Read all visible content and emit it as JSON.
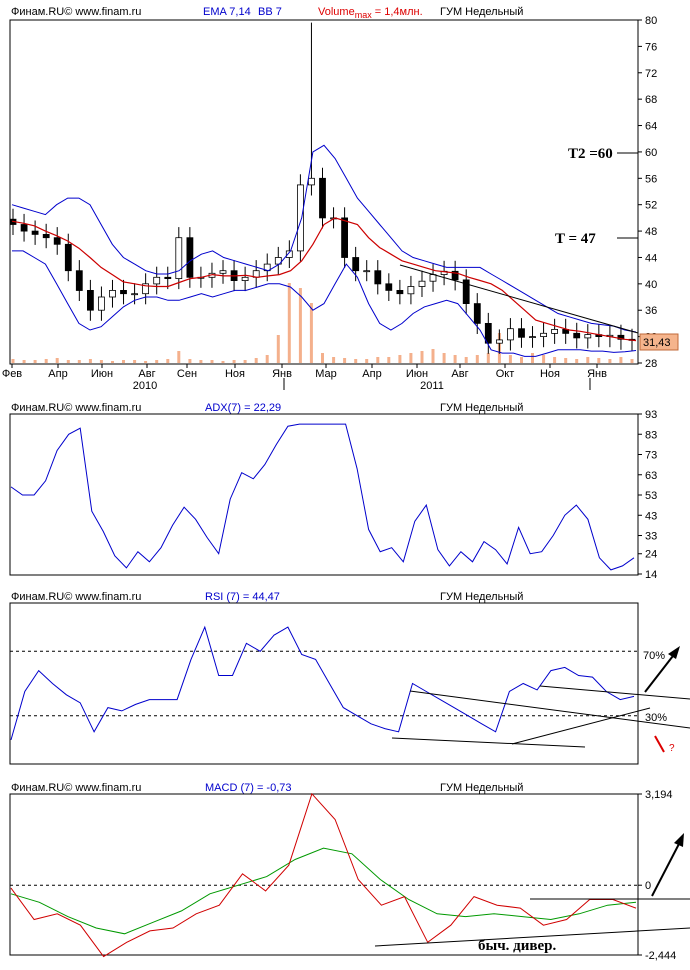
{
  "source_label": "Финам.RU© www.finam.ru",
  "instrument": "ГУМ Недельный",
  "panels": {
    "price": {
      "indicators": [
        "EMA 7,14",
        "BB 7"
      ],
      "volume_prefix": "Volume",
      "volume_sub": "max",
      "volume_value": " = 1,4млн.",
      "last_price": "31,43",
      "annotations": [
        "T2 =60",
        "T = 47"
      ]
    },
    "adx": {
      "label": "ADX(7) = 22,29"
    },
    "rsi": {
      "label": "RSI (7) = 44,47",
      "level_high": "70%",
      "level_low": "30%",
      "question": "?"
    },
    "macd": {
      "label": "MACD (7) = -0,73",
      "divergence_note": "быч. дивер."
    }
  },
  "colors": {
    "price_up": "#ffffff",
    "price_down": "#000000",
    "ema": "#cc0000",
    "bb": "#0000cc",
    "volume": "#f4b08c",
    "adx": "#0000cc",
    "rsi": "#0000cc",
    "macd": "#d00000",
    "macd_signal": "#009900",
    "last_price_bg": "#f5b48c",
    "header_blue": "#0000cc",
    "header_red": "#dd0000"
  },
  "chart_data": [
    {
      "type": "line",
      "subtype": "candlestick",
      "yaxis_side": "right",
      "ylim": [
        28,
        80
      ],
      "yticks": [
        28,
        32,
        36,
        40,
        44,
        48,
        52,
        56,
        60,
        64,
        68,
        72,
        76,
        80
      ],
      "xtick_labels": [
        "Фев",
        "Апр",
        "Июн",
        "Авг",
        "Сен",
        "Ноя",
        "Янв",
        "Мар",
        "Апр",
        "Июн",
        "Авг",
        "Окт",
        "Ноя",
        "Янв"
      ],
      "year_labels": [
        "2010",
        "2011"
      ],
      "series": [
        {
          "name": "EMA 7,14",
          "values": [
            49.5,
            49.2,
            48.8,
            48.0,
            47.3,
            46.5,
            45.4,
            44.0,
            42.5,
            41.4,
            40.3,
            40.0,
            39.7,
            39.6,
            39.6,
            40.2,
            40.8,
            41.0,
            41.4,
            41.2,
            41.2,
            41.3,
            41.0,
            41.2,
            41.4,
            42.0,
            43.5,
            46.0,
            49.0,
            50.0,
            49.5,
            49.0,
            47.0,
            45.5,
            44.5,
            43.5,
            43.0,
            42.5,
            42.0,
            41.8,
            41.6,
            41.0,
            40.5,
            40.0,
            39.0,
            37.5,
            36.0,
            34.5,
            34.0,
            33.5,
            33.0,
            32.8,
            32.5,
            32.2,
            31.9,
            31.6,
            31.4
          ]
        },
        {
          "name": "BB 7 upper",
          "values": [
            52,
            51.5,
            51,
            50.5,
            52,
            53,
            53,
            52,
            49,
            46,
            44,
            43,
            42,
            41.5,
            41.5,
            42,
            43.5,
            44.5,
            45,
            44,
            43.5,
            43,
            42.5,
            42,
            43,
            45,
            50,
            60,
            61,
            59,
            56,
            53,
            51,
            49,
            47,
            45,
            44,
            43.5,
            43,
            42.5,
            42.5,
            42.5,
            42.5,
            41.5,
            40.5,
            39.5,
            38.5,
            37.5,
            36.5,
            35.5,
            35,
            34.5,
            34,
            33.8,
            33.6,
            33,
            32.7
          ]
        },
        {
          "name": "BB 7 lower",
          "values": [
            45,
            45,
            44,
            43,
            40,
            37,
            34,
            33,
            33.5,
            35,
            36.5,
            37.5,
            38,
            38,
            37.5,
            37.5,
            38,
            38.5,
            38,
            38.5,
            39,
            39,
            39.5,
            40,
            40,
            39.5,
            38,
            36,
            37,
            40,
            43,
            41,
            37,
            34,
            33,
            34,
            35.5,
            36.5,
            37,
            37.5,
            37,
            35,
            33,
            30,
            29.5,
            29.5,
            29,
            29,
            29.5,
            30,
            30,
            30,
            29.8,
            29.8,
            29.6,
            29.7,
            29.9
          ]
        },
        {
          "name": "close",
          "values": [
            49,
            48,
            47.5,
            47,
            46,
            42,
            39,
            36,
            38,
            39,
            38.5,
            38.5,
            40,
            41,
            40.8,
            47,
            41,
            41,
            41.6,
            42,
            40.5,
            41,
            42,
            43,
            44,
            45,
            55,
            56,
            50,
            50,
            44,
            42,
            42,
            40,
            39,
            38.5,
            39.6,
            40.4,
            41.4,
            41.9,
            40.6,
            37,
            34,
            31,
            31.5,
            33.2,
            31.9,
            32,
            32.5,
            33.1,
            32.5,
            31.8,
            32.3,
            32,
            32.2,
            31.6,
            31.43
          ]
        }
      ]
    },
    {
      "type": "line",
      "yaxis_side": "right",
      "ylim": [
        14,
        93
      ],
      "yticks": [
        14,
        24,
        33,
        43,
        53,
        63,
        73,
        83,
        93
      ],
      "series": [
        {
          "name": "ADX(7)",
          "values": [
            57,
            53,
            53,
            60,
            75,
            83,
            86,
            45,
            35,
            23,
            17,
            25,
            20,
            27,
            38,
            47,
            41,
            32,
            24,
            51,
            64,
            61,
            68,
            78,
            87,
            88,
            88,
            88,
            88,
            88,
            66,
            36,
            25,
            27,
            20,
            40,
            48,
            26,
            18,
            25,
            20,
            30,
            26,
            19,
            37,
            24,
            25,
            33,
            43,
            48,
            41,
            22,
            16,
            18,
            22
          ]
        }
      ]
    },
    {
      "type": "line",
      "yaxis_side": "right",
      "ylim": [
        0,
        100
      ],
      "levels": [
        70,
        30
      ],
      "series": [
        {
          "name": "RSI (7)",
          "values": [
            15,
            45,
            58,
            50,
            43,
            38,
            20,
            35,
            33,
            37,
            40,
            40,
            40,
            65,
            85,
            55,
            55,
            75,
            70,
            80,
            85,
            68,
            65,
            50,
            35,
            30,
            25,
            22,
            20,
            50,
            45,
            40,
            35,
            30,
            25,
            20,
            45,
            50,
            46,
            58,
            60,
            55,
            54,
            45,
            40,
            42
          ]
        }
      ]
    },
    {
      "type": "line",
      "yaxis_side": "right",
      "yticks": [
        -2.444,
        0,
        3.194
      ],
      "ytick_labels": [
        "-2,444",
        "0",
        "3,194"
      ],
      "series": [
        {
          "name": "MACD (7)",
          "values": [
            -0.1,
            -1.2,
            -1.0,
            -1.4,
            -2.5,
            -2.0,
            -1.6,
            -1.5,
            -1.0,
            -0.7,
            0.4,
            -0.2,
            0.7,
            3.2,
            2.3,
            0.2,
            -0.7,
            -0.4,
            -2.0,
            -1.4,
            -0.4,
            -0.7,
            -0.8,
            -1.4,
            -1.2,
            -0.5,
            -0.5,
            -0.8
          ]
        },
        {
          "name": "Signal",
          "values": [
            -0.3,
            -0.6,
            -1.1,
            -1.5,
            -1.7,
            -1.3,
            -0.9,
            -0.3,
            0.0,
            0.3,
            0.9,
            1.3,
            1.1,
            0.2,
            -0.5,
            -1.0,
            -1.1,
            -1.0,
            -1.1,
            -1.2,
            -1.0,
            -0.7,
            -0.6
          ]
        }
      ]
    }
  ]
}
